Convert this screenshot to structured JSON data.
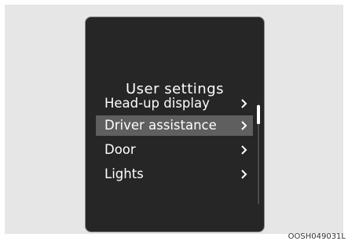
{
  "screen": {
    "title": "User settings",
    "menu_items": [
      {
        "label": "Head-up display",
        "selected": false
      },
      {
        "label": "Driver assistance",
        "selected": true
      },
      {
        "label": "Door",
        "selected": false
      },
      {
        "label": "Lights",
        "selected": false
      }
    ],
    "chevron_icon": "chevron-right-icon"
  },
  "figure": {
    "reference_code": "OOSH049031L"
  },
  "colors": {
    "screen_background": "#262626",
    "selected_highlight": "#5f5f5f",
    "text": "#ffffff",
    "page_backdrop": "#e6e6e6"
  }
}
